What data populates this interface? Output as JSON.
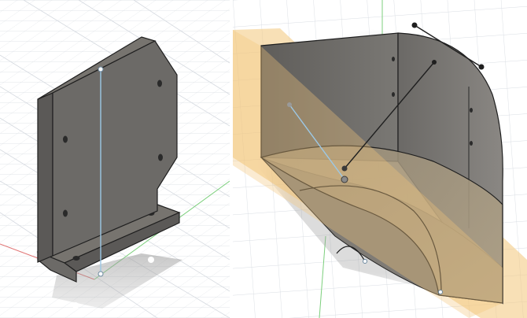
{
  "colors": {
    "background": "#ffffff",
    "grid": "#d9dde3",
    "grid_major": "#c7ccd4",
    "body_dark": "#5b5957",
    "body_mid": "#6c6a67",
    "body_top": "#77746f",
    "edge": "#1f1f1f",
    "sketch_line": "#9cc8e6",
    "section_plane": "#f3c77a",
    "axis_red": "#e07272",
    "axis_green": "#7ccf7c"
  },
  "panels": {
    "left": {
      "view": "bracket-part-isometric"
    },
    "right": {
      "view": "quarter-cylinder-section-plane"
    }
  }
}
